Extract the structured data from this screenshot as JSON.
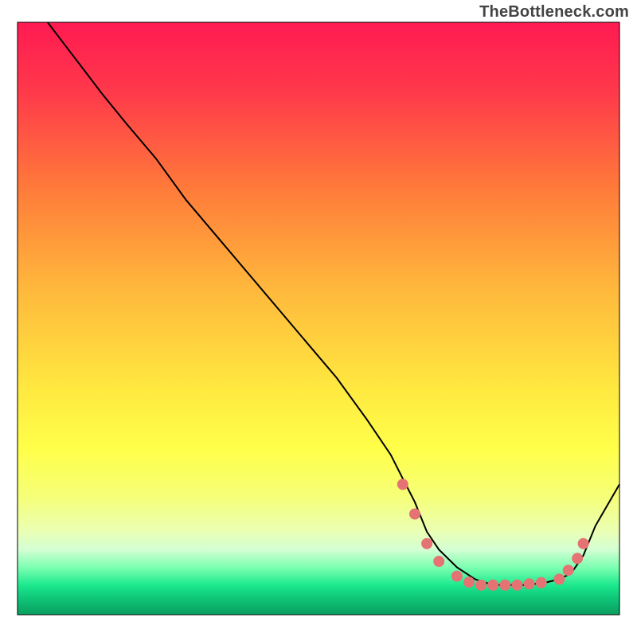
{
  "watermark": "TheBottleneck.com",
  "chart_data": {
    "type": "line",
    "title": "",
    "xlabel": "",
    "ylabel": "",
    "xlim": [
      0,
      100
    ],
    "ylim": [
      0,
      100
    ],
    "x_ticks": [],
    "y_ticks": [],
    "legend": [],
    "background": {
      "type": "vertical-gradient",
      "stops": [
        {
          "pos": 0.0,
          "color": "#ff1a52"
        },
        {
          "pos": 0.12,
          "color": "#ff3a4a"
        },
        {
          "pos": 0.28,
          "color": "#ff7a3a"
        },
        {
          "pos": 0.45,
          "color": "#ffb83c"
        },
        {
          "pos": 0.62,
          "color": "#ffe940"
        },
        {
          "pos": 0.72,
          "color": "#ffff49"
        },
        {
          "pos": 0.8,
          "color": "#f6ff77"
        },
        {
          "pos": 0.86,
          "color": "#eaffb5"
        },
        {
          "pos": 0.89,
          "color": "#d4ffd4"
        },
        {
          "pos": 0.92,
          "color": "#7dffb1"
        },
        {
          "pos": 0.95,
          "color": "#1ce98e"
        },
        {
          "pos": 0.97,
          "color": "#0fc97a"
        },
        {
          "pos": 1.0,
          "color": "#0a9e5f"
        }
      ]
    },
    "series": [
      {
        "name": "curve",
        "color": "#000000",
        "stroke_width": 2,
        "x": [
          5,
          8,
          11,
          14,
          18,
          23,
          28,
          33,
          38,
          43,
          48,
          53,
          58,
          62,
          64,
          66,
          68,
          70,
          73,
          76,
          79,
          82,
          84,
          86,
          88,
          90,
          92,
          94,
          96,
          100
        ],
        "y": [
          100,
          96,
          92,
          88,
          83,
          77,
          70,
          64,
          58,
          52,
          46,
          40,
          33,
          27,
          23,
          19,
          14,
          11,
          8,
          6,
          5,
          5,
          5,
          5.2,
          5.5,
          6,
          7,
          10,
          15,
          22
        ]
      }
    ],
    "markers": [
      {
        "name": "dot",
        "x": 64.0,
        "y": 22.0,
        "r": 7,
        "color": "#e57373"
      },
      {
        "name": "dot",
        "x": 66.0,
        "y": 17.0,
        "r": 7,
        "color": "#e57373"
      },
      {
        "name": "dot",
        "x": 68.0,
        "y": 12.0,
        "r": 7,
        "color": "#e57373"
      },
      {
        "name": "dot",
        "x": 70.0,
        "y": 9.0,
        "r": 7,
        "color": "#e57373"
      },
      {
        "name": "dot",
        "x": 73.0,
        "y": 6.5,
        "r": 7,
        "color": "#e57373"
      },
      {
        "name": "dot",
        "x": 75.0,
        "y": 5.5,
        "r": 7,
        "color": "#e57373"
      },
      {
        "name": "dot",
        "x": 77.0,
        "y": 5.0,
        "r": 7,
        "color": "#e57373"
      },
      {
        "name": "dot",
        "x": 79.0,
        "y": 5.0,
        "r": 7,
        "color": "#e57373"
      },
      {
        "name": "dot",
        "x": 81.0,
        "y": 5.0,
        "r": 7,
        "color": "#e57373"
      },
      {
        "name": "dot",
        "x": 83.0,
        "y": 5.0,
        "r": 7,
        "color": "#e57373"
      },
      {
        "name": "dot",
        "x": 85.0,
        "y": 5.2,
        "r": 7,
        "color": "#e57373"
      },
      {
        "name": "dot",
        "x": 87.0,
        "y": 5.4,
        "r": 7,
        "color": "#e57373"
      },
      {
        "name": "dot",
        "x": 90.0,
        "y": 6.0,
        "r": 7,
        "color": "#e57373"
      },
      {
        "name": "dot",
        "x": 91.5,
        "y": 7.5,
        "r": 7,
        "color": "#e57373"
      },
      {
        "name": "dot",
        "x": 93.0,
        "y": 9.5,
        "r": 7,
        "color": "#e57373"
      },
      {
        "name": "dot",
        "x": 94.0,
        "y": 12.0,
        "r": 7,
        "color": "#e57373"
      }
    ],
    "notes": "Axes have no visible tick marks or numeric labels. Values above are read off proportionally: x and y both span 0–100 across the plotting area. The black curve descends steeply from the top-left to a flat minimum near x≈80 and rises again toward the right edge. Salmon-colored circular markers cluster along the trough of the curve."
  }
}
